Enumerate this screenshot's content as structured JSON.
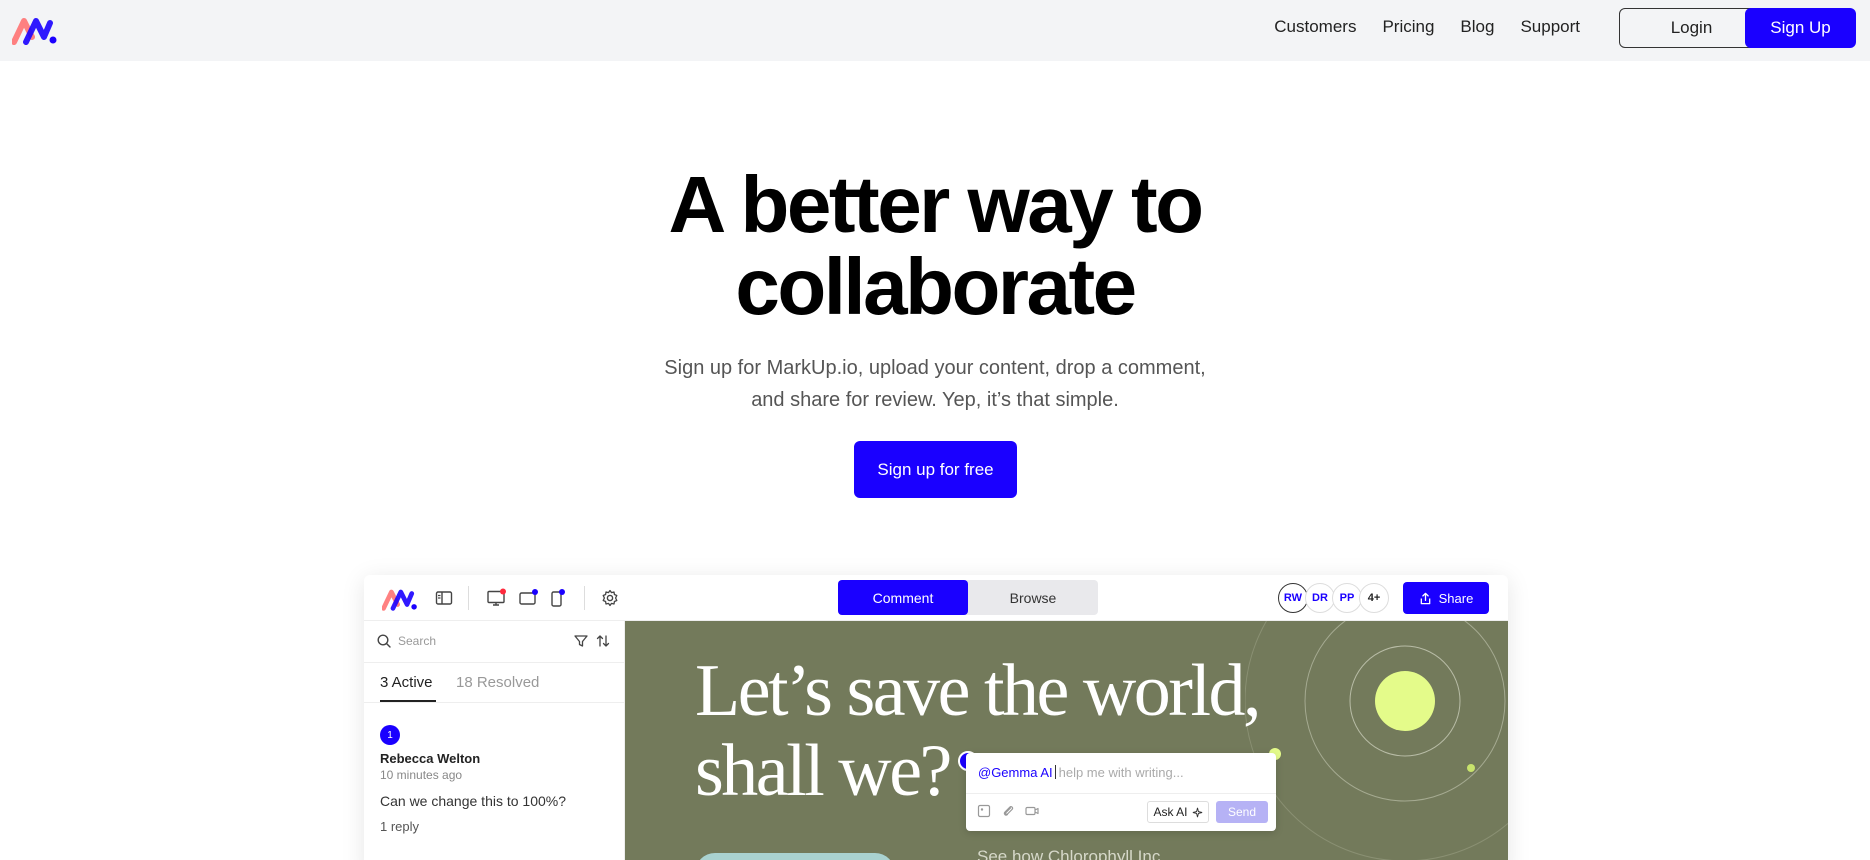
{
  "nav": {
    "links": [
      "Customers",
      "Pricing",
      "Blog",
      "Support"
    ],
    "login_label": "Login",
    "signup_label": "Sign Up"
  },
  "hero": {
    "title_line1": "A better way to",
    "title_line2": "collaborate",
    "subtitle_line1": "Sign up for MarkUp.io, upload your content, drop a comment,",
    "subtitle_line2": "and share for review. Yep, it’s that simple.",
    "cta_label": "Sign up for free"
  },
  "app": {
    "mode_tabs": [
      "Comment",
      "Browse"
    ],
    "active_mode": "Comment",
    "avatars": [
      "RW",
      "DR",
      "PP",
      "4+"
    ],
    "share_label": "Share",
    "sidebar": {
      "search_placeholder": "Search",
      "tab_active": "3 Active",
      "tab_resolved": "18 Resolved",
      "comment": {
        "number": "1",
        "author": "Rebecca Welton",
        "time": "10 minutes ago",
        "text": "Can we change this to 100%?",
        "replies": "1 reply"
      }
    },
    "canvas": {
      "headline_line1": "Let’s save the world,",
      "headline_line2": "shall we?",
      "subtext": "See how Chlorophyll Inc"
    },
    "ai_box": {
      "mention": "@Gemma AI",
      "placeholder": "help me with writing...",
      "ask_label": "Ask AI",
      "send_label": "Send"
    }
  },
  "colors": {
    "brand": "#1a00ff",
    "nav_bg": "#f3f4f6",
    "canvas_bg": "#737a5b",
    "accent_lime": "#e4fb8a"
  },
  "icons": {
    "sidebar_toggle": "sidebar-icon",
    "desktop": "desktop-icon",
    "tablet": "tablet-icon",
    "mobile": "mobile-icon",
    "settings": "gear-icon",
    "search": "search-icon",
    "filter": "filter-icon",
    "sort": "sort-icon",
    "share": "share-icon"
  }
}
